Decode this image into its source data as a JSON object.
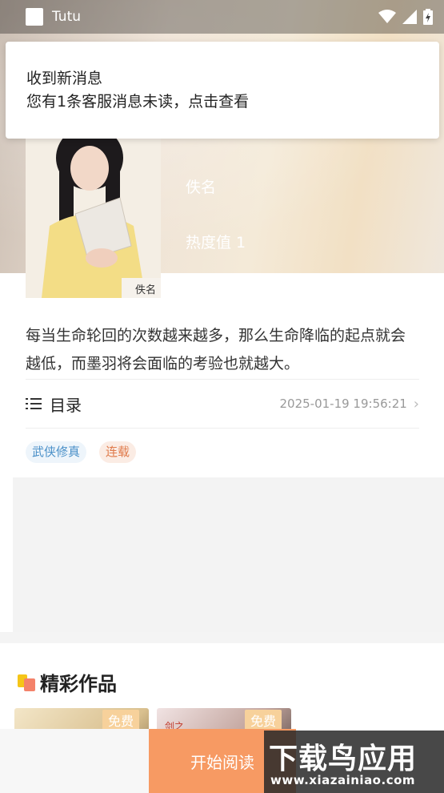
{
  "status_bar": {
    "app_name": "Tutu"
  },
  "notification": {
    "title": "收到新消息",
    "body": "您有1条客服消息未读，点击查看"
  },
  "book": {
    "cover_label": "佚名",
    "author": "佚名",
    "heat": "热度值 1",
    "intro": "每当生命轮回的次数越来越多，那么生命降临的起点就会越低，而墨羽将会面临的考验也就越大。"
  },
  "catalog": {
    "label": "目录",
    "updated": "2025-01-19 19:56:21"
  },
  "tags": [
    "武侠修真",
    "连载"
  ],
  "featured": {
    "title": "精彩作品",
    "works": [
      {
        "badge": "免费"
      },
      {
        "badge": "免费",
        "cover_text": "剑之"
      }
    ]
  },
  "actions": {
    "start_reading": "开始阅读"
  },
  "watermark": {
    "main": "下载鸟应用",
    "url": "www.xiazainiao.com"
  },
  "colors": {
    "accent": "#f79a63",
    "tag_blue": "#4a90c8",
    "tag_orange": "#e07b4c"
  }
}
